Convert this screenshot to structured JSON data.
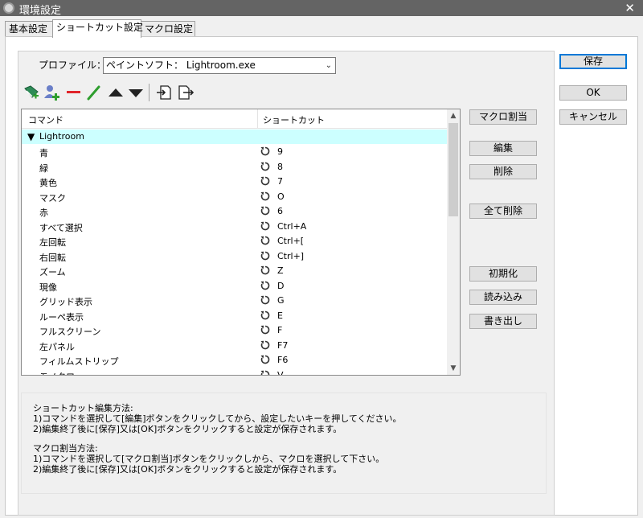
{
  "window": {
    "title": "環境設定",
    "close_glyph": "✕"
  },
  "tabs": [
    {
      "label": "基本設定"
    },
    {
      "label": "ショートカット設定"
    },
    {
      "label": "マクロ設定"
    }
  ],
  "profile": {
    "label": "プロファイル：",
    "value": "ペイントソフト： Lightroom.exe"
  },
  "toolbar": {
    "icons": [
      "add-group-icon",
      "add-user-icon",
      "remove-icon",
      "edit-pencil-icon",
      "move-up-icon",
      "move-down-icon",
      "import-icon",
      "export-icon"
    ]
  },
  "list": {
    "headers": {
      "command": "コマンド",
      "shortcut": "ショートカット"
    },
    "group": "Lightroom",
    "rows": [
      {
        "command": "青",
        "key": "9"
      },
      {
        "command": "緑",
        "key": "8"
      },
      {
        "command": "黄色",
        "key": "7"
      },
      {
        "command": "マスク",
        "key": "O"
      },
      {
        "command": "赤",
        "key": "6"
      },
      {
        "command": "すべて選択",
        "key": "Ctrl+A"
      },
      {
        "command": "左回転",
        "key": "Ctrl+["
      },
      {
        "command": "右回転",
        "key": "Ctrl+]"
      },
      {
        "command": "ズーム",
        "key": "Z"
      },
      {
        "command": "現像",
        "key": "D"
      },
      {
        "command": "グリッド表示",
        "key": "G"
      },
      {
        "command": "ルーペ表示",
        "key": "E"
      },
      {
        "command": "フルスクリーン",
        "key": "F"
      },
      {
        "command": "左パネル",
        "key": "F7"
      },
      {
        "command": "フィルムストリップ",
        "key": "F6"
      },
      {
        "command": "モノクロ",
        "key": "V"
      }
    ]
  },
  "side_buttons": {
    "macro_assign": "マクロ割当",
    "edit": "編集",
    "delete": "削除",
    "delete_all": "全て削除",
    "reset": "初期化",
    "load": "読み込み",
    "write": "書き出し"
  },
  "dialog_buttons": {
    "save": "保存",
    "ok": "OK",
    "cancel": "キャンセル"
  },
  "help": {
    "lines": [
      "ショートカット編集方法:",
      " 1)コマンドを選択して[編集]ボタンをクリックしてから、設定したいキーを押してください。",
      " 2)編集終了後に[保存]又は[OK]ボタンをクリックすると設定が保存されます。",
      "",
      "マクロ割当方法:",
      " 1)コマンドを選択して[マクロ割当]ボタンをクリックしから、マクロを選択して下さい。",
      " 2)編集終了後に[保存]又は[OK]ボタンをクリックすると設定が保存されます。"
    ]
  },
  "colors": {
    "titlebar": "#646464",
    "group_row": "#ccffff",
    "accent": "#0078d7",
    "remove_icon": "#e0242a",
    "pencil_icon": "#2e9e2e"
  }
}
